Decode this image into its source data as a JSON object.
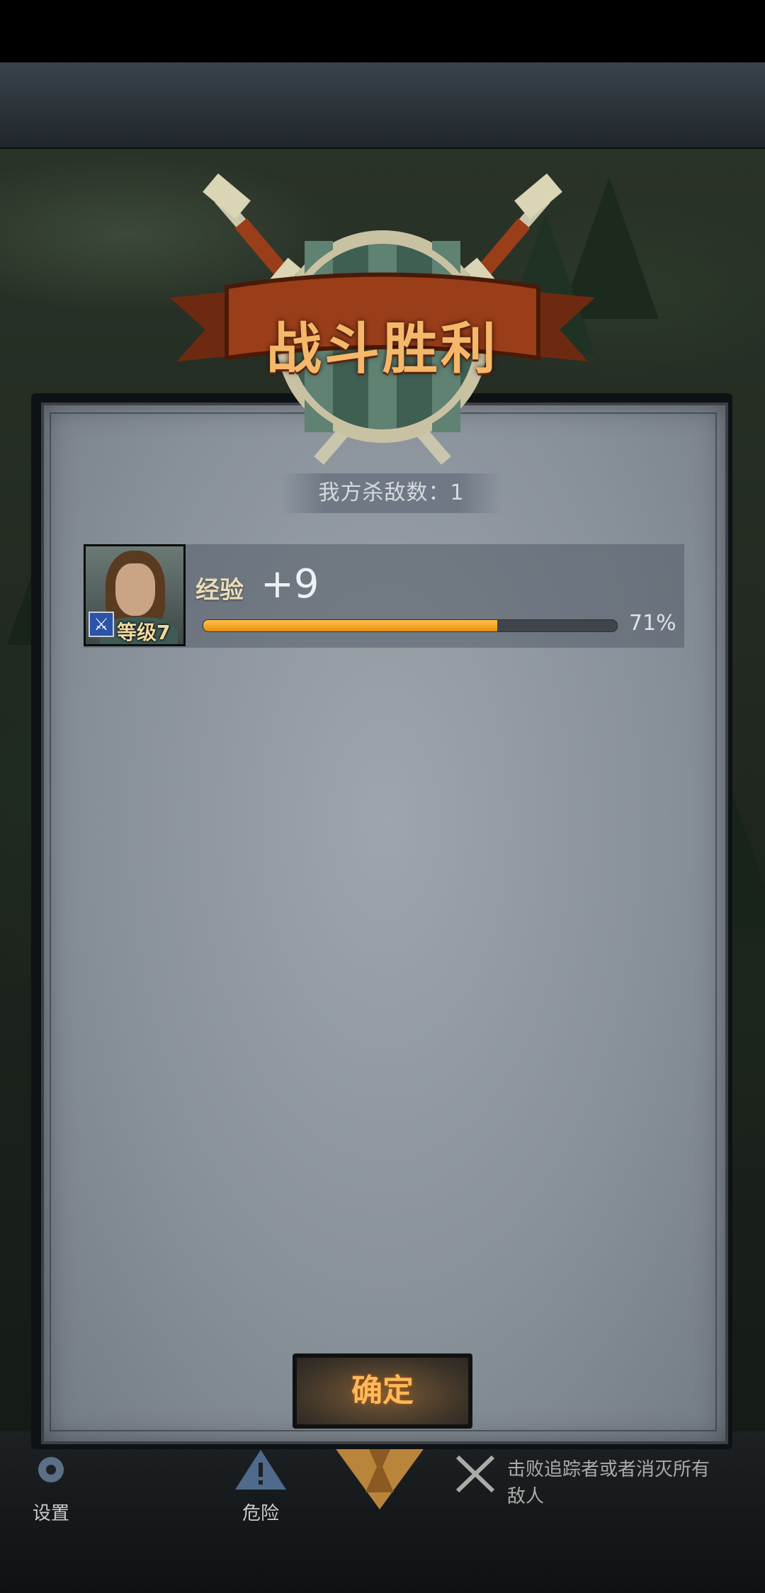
{
  "title": "战斗胜利",
  "kill_count_text": "我方杀敌数：1",
  "hero": {
    "level_text": "等级7",
    "exp_label": "经验",
    "exp_gain": "+9",
    "progress_percent_text": "71%",
    "progress_value": 0.71
  },
  "confirm_label": "确定",
  "bottom_nav": {
    "settings_label": "设置",
    "danger_label": "危险",
    "hint_line1": "击败追踪者或者消灭所有",
    "hint_line2": "敌人"
  },
  "colors": {
    "accent_orange": "#e58f10",
    "title_text": "#f5b86a",
    "banner_red": "#9a3e1a"
  }
}
